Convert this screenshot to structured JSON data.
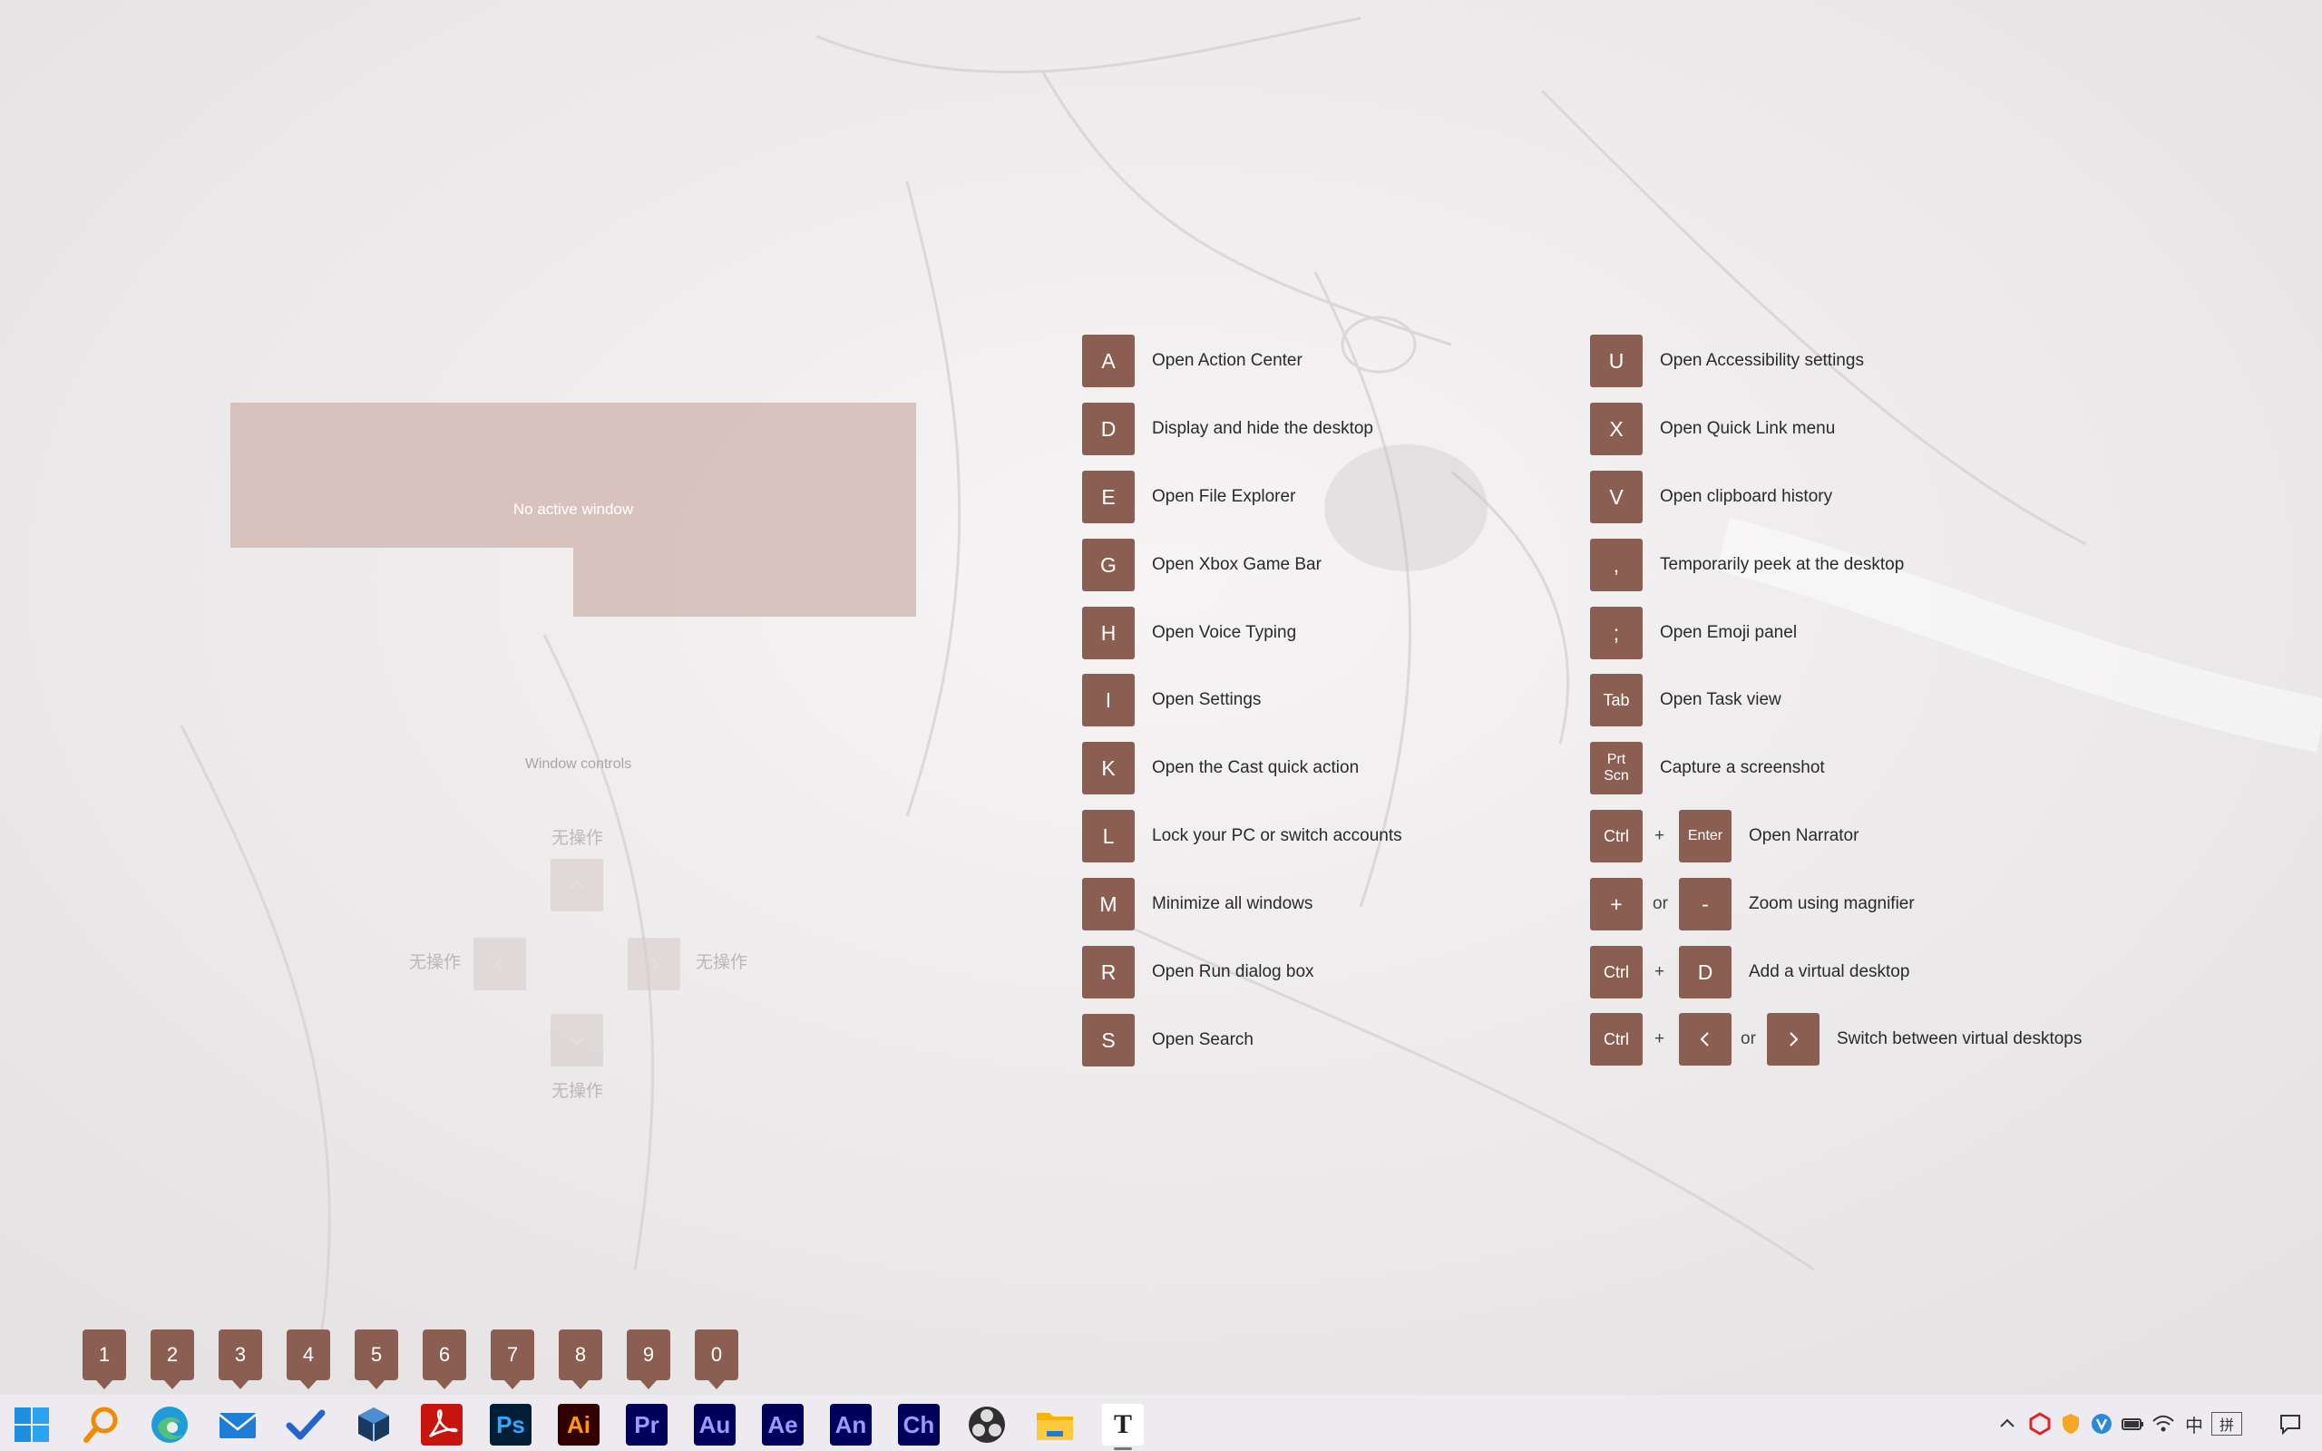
{
  "snap_preview": {
    "label": "No active window"
  },
  "window_controls": {
    "title": "Window controls",
    "up_label": "无操作",
    "down_label": "无操作",
    "left_label": "无操作",
    "right_label": "无操作"
  },
  "shortcuts_left": [
    {
      "key": "A",
      "desc": "Open Action Center"
    },
    {
      "key": "D",
      "desc": "Display and hide the desktop"
    },
    {
      "key": "E",
      "desc": "Open File Explorer"
    },
    {
      "key": "G",
      "desc": "Open Xbox Game Bar"
    },
    {
      "key": "H",
      "desc": "Open Voice Typing"
    },
    {
      "key": "I",
      "desc": "Open Settings"
    },
    {
      "key": "K",
      "desc": "Open the Cast quick action"
    },
    {
      "key": "L",
      "desc": "Lock your PC or switch accounts"
    },
    {
      "key": "M",
      "desc": "Minimize all windows"
    },
    {
      "key": "R",
      "desc": "Open Run dialog box"
    },
    {
      "key": "S",
      "desc": "Open Search"
    }
  ],
  "shortcuts_right": {
    "u": {
      "key": "U",
      "desc": "Open Accessibility settings"
    },
    "x": {
      "key": "X",
      "desc": "Open Quick Link menu"
    },
    "v": {
      "key": "V",
      "desc": "Open clipboard history"
    },
    "comma": {
      "key": ",",
      "desc": "Temporarily peek at the desktop"
    },
    "semicolon": {
      "key": ";",
      "desc": "Open Emoji panel"
    },
    "tab": {
      "key": "Tab",
      "desc": "Open Task view"
    },
    "prtscn": {
      "key_line1": "Prt",
      "key_line2": "Scn",
      "desc": "Capture a screenshot"
    },
    "narrator": {
      "key1": "Ctrl",
      "plus": "+",
      "key2": "Enter",
      "desc": "Open Narrator"
    },
    "magnifier": {
      "key1": "+",
      "or": "or",
      "key2": "-",
      "desc": "Zoom using magnifier"
    },
    "vdesk_add": {
      "key1": "Ctrl",
      "plus": "+",
      "key2": "D",
      "desc": "Add a virtual desktop"
    },
    "vdesk_switch": {
      "key1": "Ctrl",
      "plus": "+",
      "or": "or",
      "desc": "Switch between virtual desktops"
    }
  },
  "number_badges": [
    "1",
    "2",
    "3",
    "4",
    "5",
    "6",
    "7",
    "8",
    "9",
    "0"
  ],
  "taskbar": {
    "apps": [
      {
        "name": "start",
        "icon": "windows-logo-icon"
      },
      {
        "name": "search",
        "icon": "magnifier-icon"
      },
      {
        "name": "edge",
        "icon": "edge-icon"
      },
      {
        "name": "mail",
        "icon": "mail-icon"
      },
      {
        "name": "todo",
        "icon": "check-icon"
      },
      {
        "name": "virtualbox",
        "icon": "cube-icon"
      },
      {
        "name": "acrobat",
        "icon": "acrobat-icon"
      },
      {
        "name": "photoshop",
        "label": "Ps",
        "bg": "#001e36",
        "fg": "#31a8ff"
      },
      {
        "name": "illustrator",
        "label": "Ai",
        "bg": "#330000",
        "fg": "#ff9a00"
      },
      {
        "name": "premiere",
        "label": "Pr",
        "bg": "#00005b",
        "fg": "#9999ff"
      },
      {
        "name": "audition",
        "label": "Au",
        "bg": "#00005b",
        "fg": "#9999ff"
      },
      {
        "name": "aftereffects",
        "label": "Ae",
        "bg": "#00005b",
        "fg": "#9999ff"
      },
      {
        "name": "animate",
        "label": "An",
        "bg": "#00005b",
        "fg": "#9999ff"
      },
      {
        "name": "character",
        "label": "Ch",
        "bg": "#00005b",
        "fg": "#9999ff"
      },
      {
        "name": "obs",
        "icon": "obs-icon"
      },
      {
        "name": "explorer",
        "icon": "folder-icon"
      },
      {
        "name": "typora",
        "label": "T",
        "icon": "typora-icon"
      }
    ],
    "tray": {
      "ime": "中",
      "ime_mode": "拼"
    }
  },
  "colors": {
    "key_bg": "#8b5e52",
    "snap_bg": "#cdb2ac"
  }
}
